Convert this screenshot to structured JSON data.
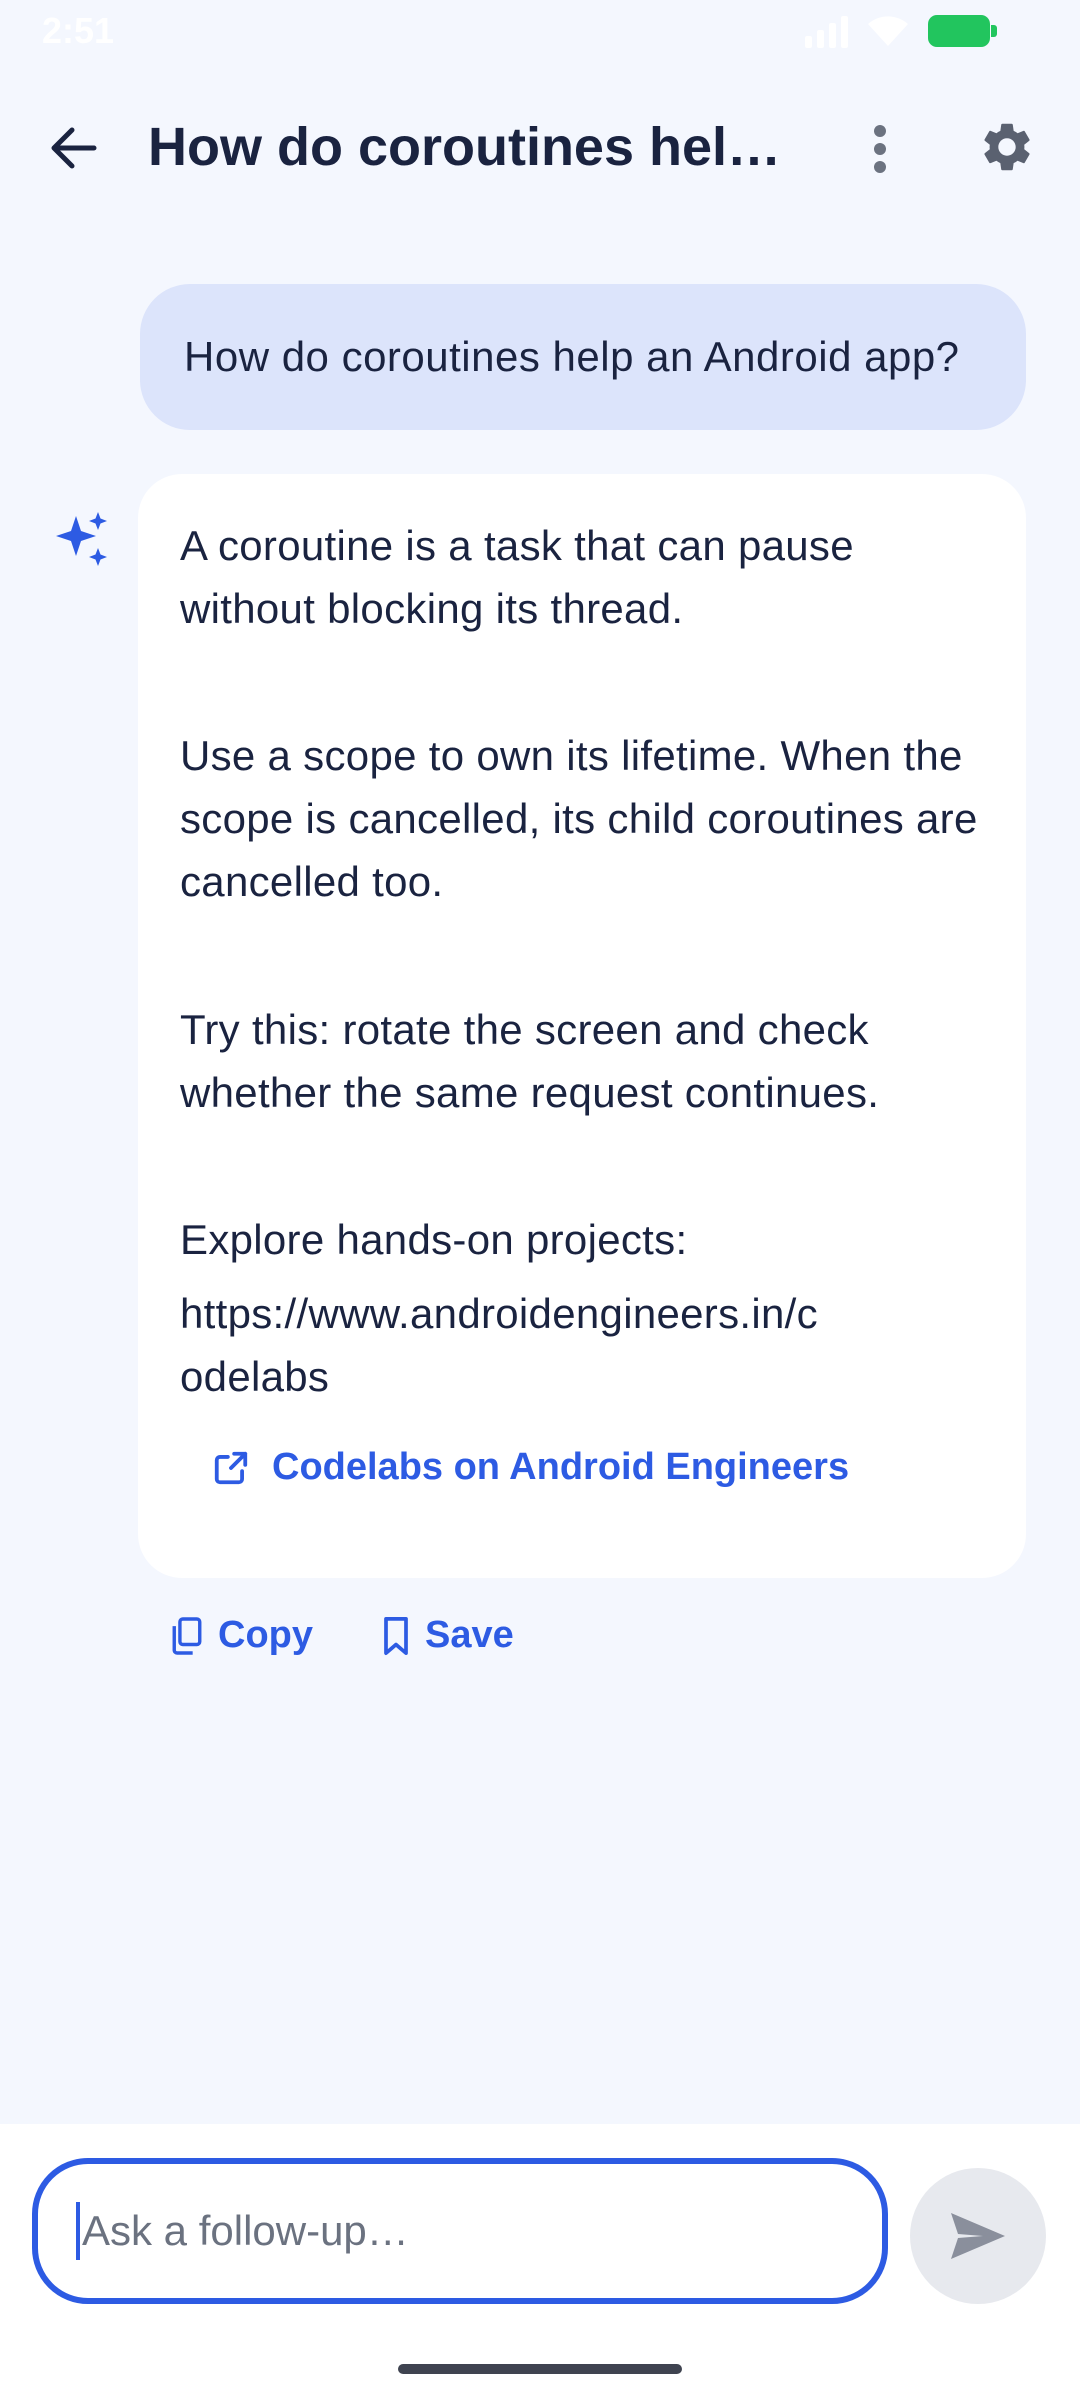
{
  "status_bar": {
    "time": "2:51"
  },
  "app_bar": {
    "title": "How do coroutines help…"
  },
  "conversation": {
    "user_message": "How do coroutines help an Android app?",
    "assistant": {
      "paragraphs": [
        "A coroutine is a task that can pause without blocking its thread.",
        "Use a scope to own its lifetime. When the scope is cancelled, its child coroutines are cancelled too.",
        "Try this: rotate the screen and check whether the same request continues.",
        "Explore hands-on projects:",
        "https://www.androidengineers.in/codelabs"
      ],
      "link_label": "Codelabs on Android Engineers"
    },
    "actions": {
      "copy_label": "Copy",
      "save_label": "Save"
    }
  },
  "composer": {
    "placeholder": "Ask a follow-up…"
  },
  "colors": {
    "accent": "#2D5BE3",
    "background": "#F4F7FE",
    "user_bubble": "#DCE4FB",
    "battery": "#22C55E"
  },
  "icons": [
    "back-arrow-icon",
    "more-vert-icon",
    "gear-icon",
    "sparkle-icon",
    "open-external-icon",
    "copy-icon",
    "bookmark-icon",
    "send-icon"
  ]
}
